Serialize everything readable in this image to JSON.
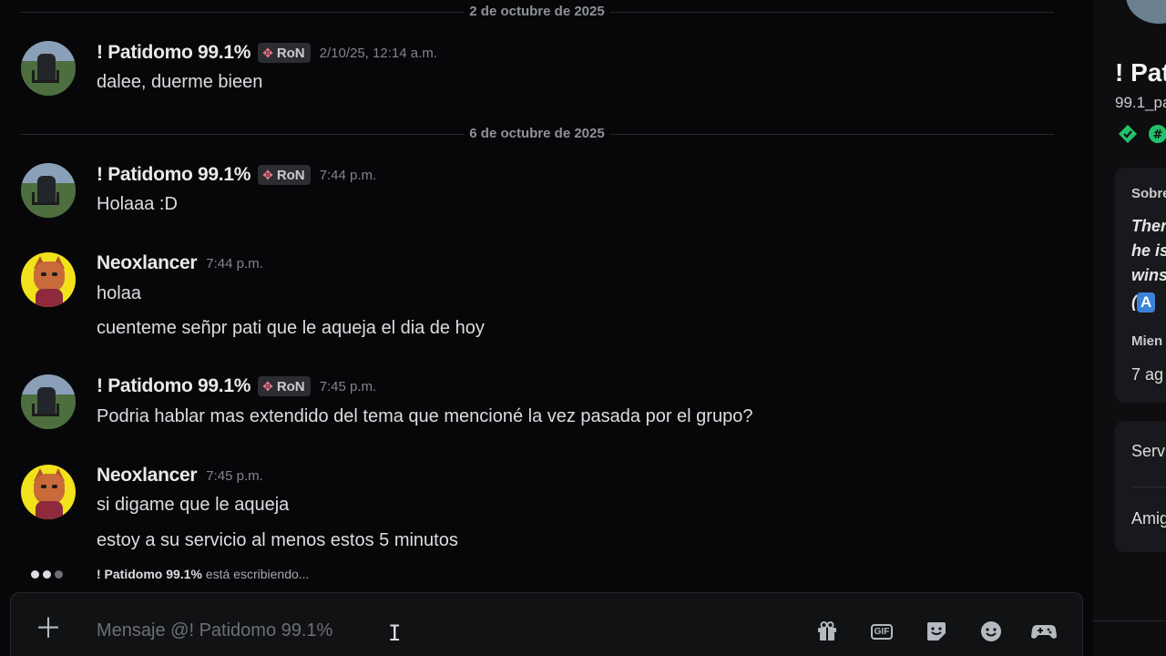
{
  "chat": {
    "dividers": [
      "2 de octubre de 2025",
      "6 de octubre de 2025"
    ],
    "messages": [
      {
        "user": "! Patidomo 99.1%",
        "badge": "RoN",
        "time": "2/10/25, 12:14 a.m.",
        "lines": [
          "dalee, duerme bieen"
        ]
      },
      {
        "user": "! Patidomo 99.1%",
        "badge": "RoN",
        "time": "7:44 p.m.",
        "lines": [
          "Holaaa :D"
        ]
      },
      {
        "user": "Neoxlancer",
        "time": "7:44 p.m.",
        "lines": [
          "holaa",
          "cuenteme señpr pati que le aqueja el dia de hoy"
        ]
      },
      {
        "user": "! Patidomo 99.1%",
        "badge": "RoN",
        "time": "7:45 p.m.",
        "lines": [
          "Podria hablar mas extendido del tema que mencioné la vez pasada por el grupo?"
        ]
      },
      {
        "user": "Neoxlancer",
        "time": "7:45 p.m.",
        "lines": [
          "si digame que le aqueja",
          "estoy a su servicio al menos estos 5 minutos"
        ]
      }
    ],
    "typing": {
      "user": "! Patidomo 99.1%",
      "suffix": "está escribiendo..."
    }
  },
  "composer": {
    "placeholder": "Mensaje @! Patidomo 99.1%"
  },
  "sidebar": {
    "name": "! Pat",
    "handle": "99.1_pa",
    "about_label": "Sobre",
    "about_lines": [
      "Ther",
      "he is",
      "wins"
    ],
    "about_key_prefix": "(",
    "about_key": "A",
    "member_label": "Mien",
    "member_value": "7 ag",
    "links": [
      "Serv",
      "Amig"
    ]
  },
  "colors": {
    "background": "#070709",
    "sidebar": "#0e0e11",
    "badge_icon": "#f27588",
    "avatar_neo": "#f2e21c"
  }
}
